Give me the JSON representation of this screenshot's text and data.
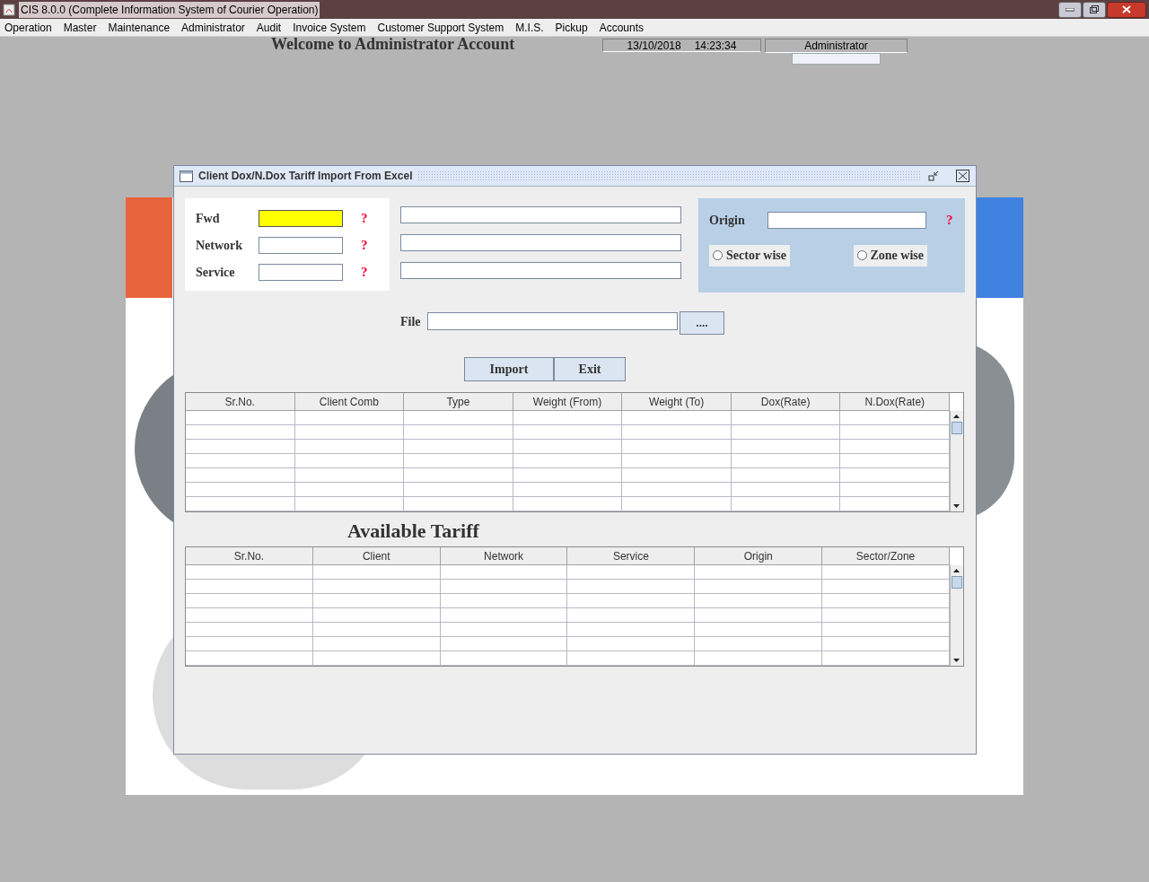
{
  "window": {
    "title": "CIS 8.0.0 (Complete Information System of Courier Operation)"
  },
  "menu": [
    "Operation",
    "Master",
    "Maintenance",
    "Administrator",
    "Audit",
    "Invoice System",
    "Customer Support System",
    "M.I.S.",
    "Pickup",
    "Accounts"
  ],
  "header": {
    "welcome": "Welcome to Administrator Account",
    "date": "13/10/2018",
    "time": "14:23:34",
    "user": "Administrator"
  },
  "dialog": {
    "title": "Client Dox/N.Dox Tariff Import From Excel",
    "fields": [
      {
        "label": "Fwd",
        "focused": true,
        "required_mark": "?"
      },
      {
        "label": "Network",
        "focused": false,
        "required_mark": "?"
      },
      {
        "label": "Service",
        "focused": false,
        "required_mark": "?"
      }
    ],
    "origin": {
      "label": "Origin",
      "required_mark": "?"
    },
    "radios": [
      {
        "label": "Sector wise",
        "selected": false
      },
      {
        "label": "Zone wise",
        "selected": false
      }
    ],
    "file": {
      "label": "File",
      "browse": "...."
    },
    "buttons": [
      "Import",
      "Exit"
    ],
    "import_table": {
      "columns": [
        "Sr.No.",
        "Client Comb",
        "Type",
        "Weight (From)",
        "Weight (To)",
        "Dox(Rate)",
        "N.Dox(Rate)"
      ]
    },
    "tariff_title": "Available Tariff",
    "tariff_table": {
      "columns": [
        "Sr.No.",
        "Client",
        "Network",
        "Service",
        "Origin",
        "Sector/Zone"
      ]
    }
  }
}
